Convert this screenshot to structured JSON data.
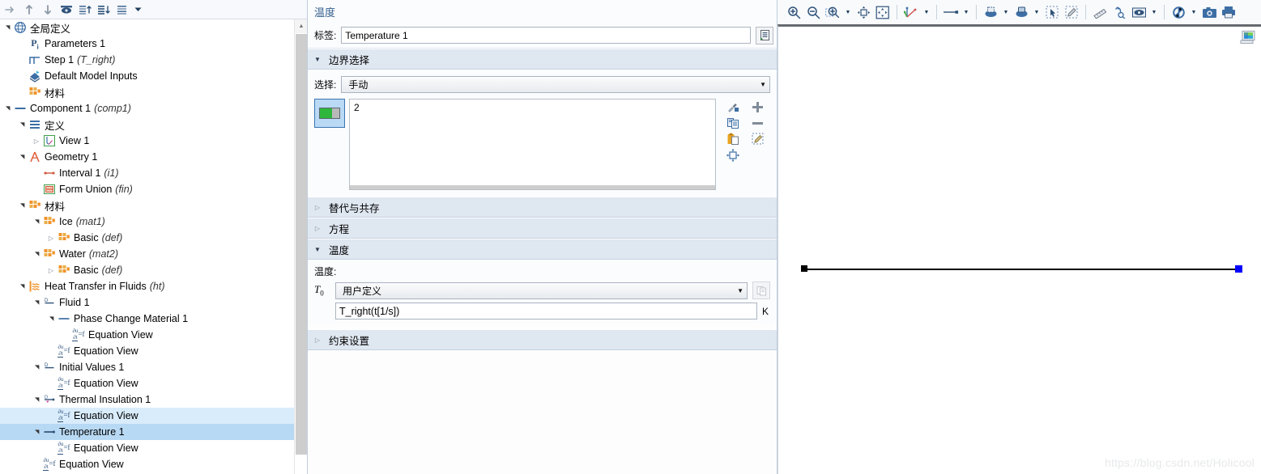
{
  "tree": {
    "toolbar": [
      {
        "name": "collapse-all-icon",
        "glyph": "→"
      },
      {
        "name": "move-up-icon",
        "glyph": "↑"
      },
      {
        "name": "move-down-icon",
        "glyph": "↓"
      },
      {
        "name": "show-hide-icon",
        "glyph": "eye"
      },
      {
        "name": "expand-selected-icon",
        "glyph": "list-up"
      },
      {
        "name": "collapse-selected-icon",
        "glyph": "list-down"
      },
      {
        "name": "list-view-icon",
        "glyph": "list"
      },
      {
        "name": "list-view-dropdown-icon",
        "glyph": "▼"
      }
    ],
    "items": [
      {
        "label": "全局定义",
        "tag": "",
        "indent": 0,
        "twisty": "expanded",
        "icon": "globe-icon",
        "state": "none"
      },
      {
        "label": "Parameters 1",
        "tag": "",
        "indent": 1,
        "twisty": "empty",
        "icon": "pi-icon",
        "state": "none"
      },
      {
        "label": "Step 1",
        "tag": "(T_right)",
        "indent": 1,
        "twisty": "empty",
        "icon": "step-icon",
        "state": "none"
      },
      {
        "label": "Default Model Inputs",
        "tag": "",
        "indent": 1,
        "twisty": "empty",
        "icon": "model-inputs-icon",
        "state": "none"
      },
      {
        "label": "材料",
        "tag": "",
        "indent": 1,
        "twisty": "empty",
        "icon": "materials-icon",
        "state": "none"
      },
      {
        "label": "Component 1",
        "tag": "(comp1)",
        "indent": 0,
        "twisty": "expanded",
        "icon": "component-icon",
        "state": "none"
      },
      {
        "label": "定义",
        "tag": "",
        "indent": 1,
        "twisty": "expanded",
        "icon": "definitions-icon",
        "state": "none"
      },
      {
        "label": "View 1",
        "tag": "",
        "indent": 2,
        "twisty": "collapsed",
        "icon": "view-icon",
        "state": "none"
      },
      {
        "label": "Geometry 1",
        "tag": "",
        "indent": 1,
        "twisty": "expanded",
        "icon": "geometry-icon",
        "state": "none"
      },
      {
        "label": "Interval 1",
        "tag": "(i1)",
        "indent": 2,
        "twisty": "empty",
        "icon": "interval-icon",
        "state": "none"
      },
      {
        "label": "Form Union",
        "tag": "(fin)",
        "indent": 2,
        "twisty": "empty",
        "icon": "form-union-icon",
        "state": "none"
      },
      {
        "label": "材料",
        "tag": "",
        "indent": 1,
        "twisty": "expanded",
        "icon": "materials-icon",
        "state": "none"
      },
      {
        "label": "Ice",
        "tag": "(mat1)",
        "indent": 2,
        "twisty": "expanded",
        "icon": "materials-icon",
        "state": "none"
      },
      {
        "label": "Basic",
        "tag": "(def)",
        "indent": 3,
        "twisty": "collapsed",
        "icon": "materials-icon",
        "state": "none"
      },
      {
        "label": "Water",
        "tag": "(mat2)",
        "indent": 2,
        "twisty": "expanded",
        "icon": "materials-icon",
        "state": "none"
      },
      {
        "label": "Basic",
        "tag": "(def)",
        "indent": 3,
        "twisty": "collapsed",
        "icon": "materials-icon",
        "state": "none"
      },
      {
        "label": "Heat Transfer in Fluids",
        "tag": "(ht)",
        "indent": 1,
        "twisty": "expanded",
        "icon": "heat-transfer-icon",
        "state": "none"
      },
      {
        "label": "Fluid 1",
        "tag": "",
        "indent": 2,
        "twisty": "expanded",
        "icon": "domain-icon",
        "state": "none"
      },
      {
        "label": "Phase Change Material 1",
        "tag": "",
        "indent": 3,
        "twisty": "expanded",
        "icon": "pcm-icon",
        "state": "none"
      },
      {
        "label": "Equation View",
        "tag": "",
        "indent": 4,
        "twisty": "empty",
        "icon": "equation-view-icon",
        "state": "none"
      },
      {
        "label": "Equation View",
        "tag": "",
        "indent": 3,
        "twisty": "empty",
        "icon": "equation-view-icon",
        "state": "none"
      },
      {
        "label": "Initial Values 1",
        "tag": "",
        "indent": 2,
        "twisty": "expanded",
        "icon": "domain-icon",
        "state": "none"
      },
      {
        "label": "Equation View",
        "tag": "",
        "indent": 3,
        "twisty": "empty",
        "icon": "equation-view-icon",
        "state": "none"
      },
      {
        "label": "Thermal Insulation 1",
        "tag": "",
        "indent": 2,
        "twisty": "expanded",
        "icon": "boundary-icon",
        "state": "none"
      },
      {
        "label": "Equation View",
        "tag": "",
        "indent": 3,
        "twisty": "empty",
        "icon": "equation-view-icon",
        "state": "hover"
      },
      {
        "label": "Temperature 1",
        "tag": "",
        "indent": 2,
        "twisty": "expanded",
        "icon": "temperature-bc-icon",
        "state": "selected"
      },
      {
        "label": "Equation View",
        "tag": "",
        "indent": 3,
        "twisty": "empty",
        "icon": "equation-view-icon",
        "state": "none"
      },
      {
        "label": "Equation View",
        "tag": "",
        "indent": 2,
        "twisty": "empty",
        "icon": "equation-view-icon",
        "state": "none"
      }
    ]
  },
  "settings": {
    "title": "温度",
    "label_caption": "标签:",
    "label_value": "Temperature 1",
    "label_icon": "rename-icon",
    "boundary_section": {
      "title": "边界选择",
      "expanded": true,
      "selection_caption": "选择:",
      "selection_value": "手动",
      "toggle_button_name": "active-selection-toggle",
      "list_values": "2",
      "side_buttons": [
        {
          "name": "paste-selection-icon",
          "glyph": "wand"
        },
        {
          "name": "add-to-selection-icon",
          "glyph": "+"
        },
        {
          "name": "copy-selection-icon",
          "glyph": "copy"
        },
        {
          "name": "remove-from-selection-icon",
          "glyph": "−"
        },
        {
          "name": "paste-clipboard-icon",
          "glyph": "clipboard"
        },
        {
          "name": "clear-selection-icon",
          "glyph": "broom"
        },
        {
          "name": "zoom-to-selection-icon",
          "glyph": "zoom-sel"
        }
      ]
    },
    "override_section": {
      "title": "替代与共存",
      "expanded": false
    },
    "equation_section": {
      "title": "方程",
      "expanded": false
    },
    "temperature_section": {
      "title": "温度",
      "expanded": true,
      "sub_label": "温度:",
      "t0_symbol": "T",
      "t0_subscript": "0",
      "t0_value": "用户定义",
      "t0_side_icon": "expression-editor-icon",
      "expression_value": "T_right(t[1/s])",
      "unit": "K"
    },
    "constraint_section": {
      "title": "约束设置",
      "expanded": false
    }
  },
  "graphics": {
    "toolbar": [
      {
        "name": "zoom-in-icon",
        "type": "btn"
      },
      {
        "name": "zoom-out-icon",
        "type": "btn"
      },
      {
        "name": "zoom-box-icon",
        "type": "btn"
      },
      {
        "name": "zoom-box-dropdown-icon",
        "type": "arrow"
      },
      {
        "name": "zoom-extents-icon",
        "type": "btn"
      },
      {
        "name": "zoom-to-fit-icon",
        "type": "btn"
      },
      {
        "name": "sep",
        "type": "sep"
      },
      {
        "name": "axis-orientation-icon",
        "type": "btn"
      },
      {
        "name": "axis-orientation-dropdown-icon",
        "type": "arrow"
      },
      {
        "name": "sep",
        "type": "sep"
      },
      {
        "name": "line-point-render-icon",
        "type": "btn"
      },
      {
        "name": "line-point-render-dropdown-icon",
        "type": "arrow"
      },
      {
        "name": "sep",
        "type": "sep"
      },
      {
        "name": "scene-light-icon",
        "type": "btn"
      },
      {
        "name": "scene-light-dropdown-icon",
        "type": "arrow"
      },
      {
        "name": "transparency-icon",
        "type": "btn"
      },
      {
        "name": "transparency-dropdown-icon",
        "type": "arrow"
      },
      {
        "name": "select-box-icon",
        "type": "btn"
      },
      {
        "name": "deselect-box-icon",
        "type": "btn"
      },
      {
        "name": "sep",
        "type": "sep"
      },
      {
        "name": "measure-icon",
        "type": "btn"
      },
      {
        "name": "select-all-icon",
        "type": "btn"
      },
      {
        "name": "view-visibility-icon",
        "type": "btn"
      },
      {
        "name": "view-visibility-dropdown-icon",
        "type": "arrow"
      },
      {
        "name": "sep",
        "type": "sep"
      },
      {
        "name": "refresh-render-icon",
        "type": "btn"
      },
      {
        "name": "refresh-render-dropdown-icon",
        "type": "arrow"
      },
      {
        "name": "snapshot-icon",
        "type": "btn"
      },
      {
        "name": "print-icon",
        "type": "btn"
      }
    ],
    "corner_icon": "graphics-window-icon",
    "geometry": {
      "type": "1d-interval",
      "left_point_color": "#000000",
      "right_point_color": "#0000ff",
      "line_color": "#000000"
    },
    "watermark": "https://blog.csdn.net/Holicool"
  }
}
